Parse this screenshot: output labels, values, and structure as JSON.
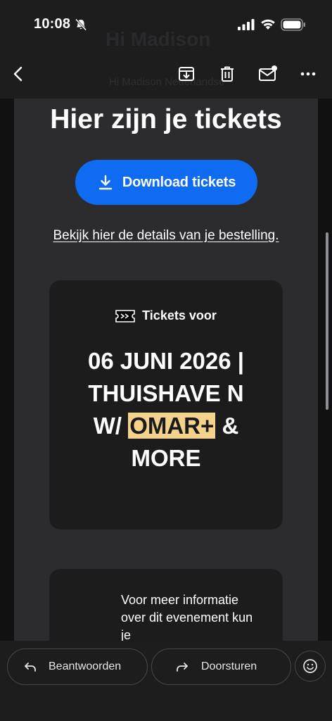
{
  "status_bar": {
    "time": "10:08"
  },
  "toolbar": {
    "ghost_title": "Hi Madison",
    "ghost_sub": "Hi Madison Nederlandse"
  },
  "email": {
    "headline": "Hier zijn je tickets",
    "download_label": "Download tickets",
    "details_link": "Bekijk hier de details van je bestelling.",
    "ticket": {
      "header_label": "Tickets voor",
      "title_before": "06 JUNI 2026 | THUISHAVE N W/ ",
      "title_highlight": "OMAR+",
      "title_after": " & MORE"
    },
    "info_text": "Voor meer informatie over dit evenement kun je"
  },
  "bottom_bar": {
    "reply_label": "Beantwoorden",
    "forward_label": "Doorsturen"
  },
  "colors": {
    "accent": "#0f6cf2",
    "highlight": "#f5d28b",
    "card": "#2c2c2e",
    "ticket_card": "#1c1c1d"
  }
}
